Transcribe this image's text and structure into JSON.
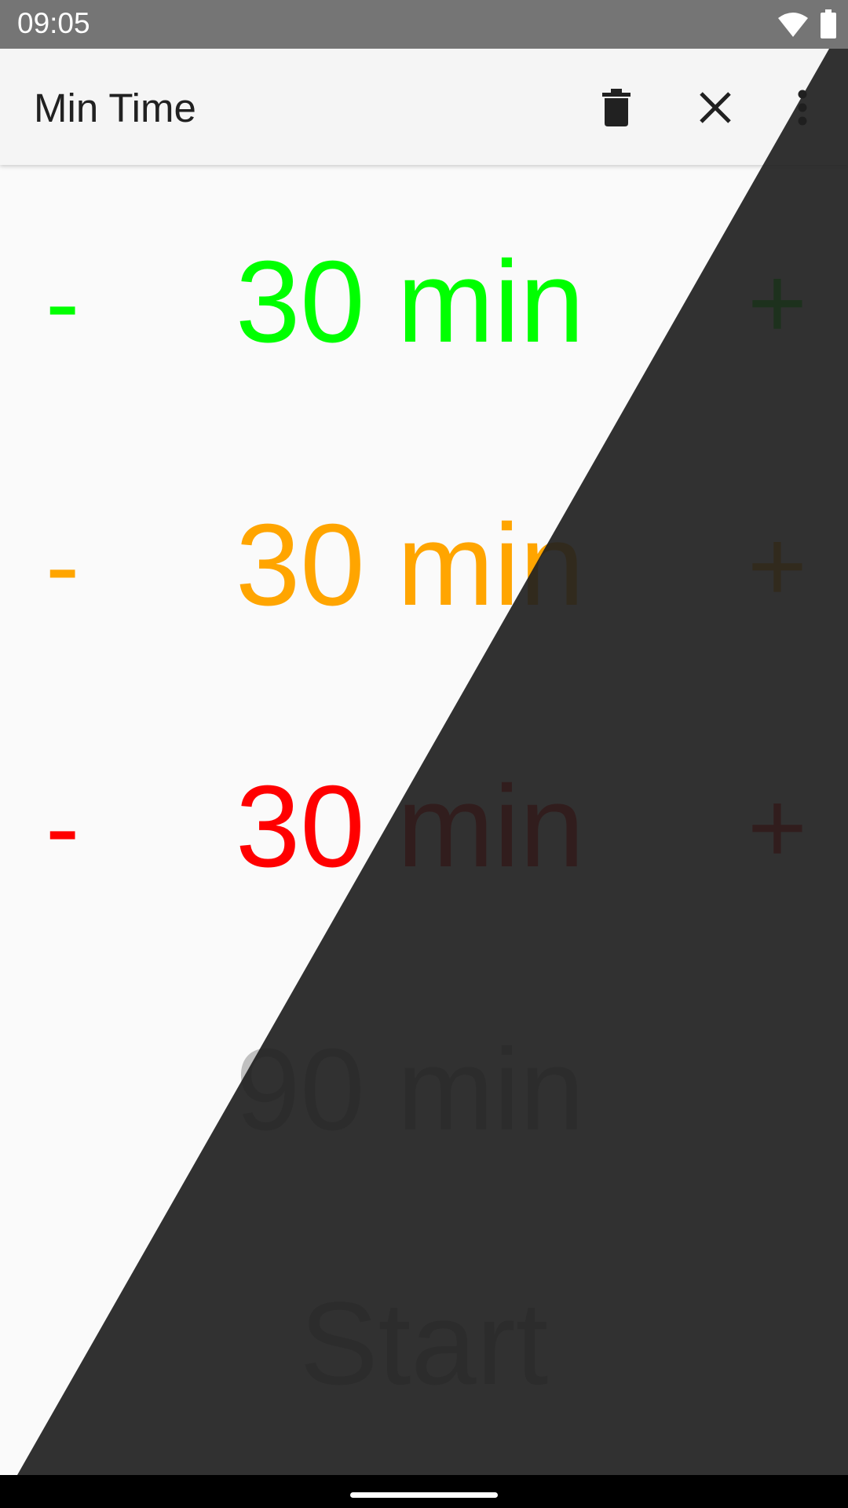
{
  "status_bar": {
    "time": "09:05",
    "icons": [
      "wifi-icon",
      "battery-icon"
    ]
  },
  "app_bar": {
    "title": "Min Time",
    "actions": [
      "trash-icon",
      "close-icon",
      "more-vert-icon"
    ]
  },
  "timers": [
    {
      "minus": "-",
      "value": "30 min",
      "plus": "+",
      "color": "#00ff00"
    },
    {
      "minus": "-",
      "value": "30 min",
      "plus": "+",
      "color": "#ffa500"
    },
    {
      "minus": "-",
      "value": "30 min",
      "plus": "+",
      "color": "#ff0000"
    }
  ],
  "total": {
    "value": "90 min",
    "color": "#c0c0c0"
  },
  "start_button": {
    "label": "Start",
    "color": "#c0c0c0"
  },
  "colors": {
    "background_light": "#fafafa",
    "background_dark": "#303030",
    "app_bar": "#f5f5f5",
    "status_bar": "#757575"
  }
}
